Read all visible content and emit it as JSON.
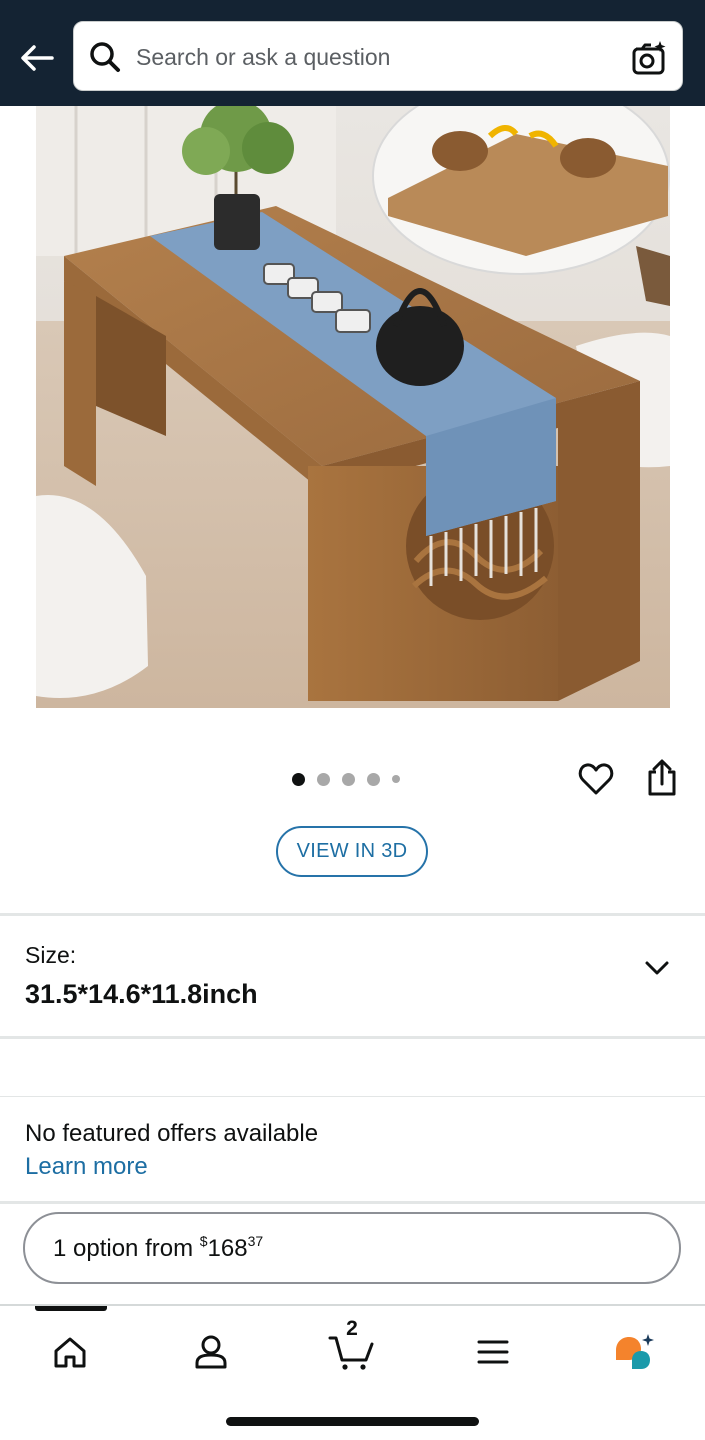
{
  "header": {
    "search_placeholder": "Search or ask a question",
    "background_color": "#142333"
  },
  "gallery": {
    "image_description_icon": "product-photo",
    "image_count": 5,
    "active_index": 0
  },
  "actions": {
    "view_3d_label": "VIEW IN 3D"
  },
  "size": {
    "label": "Size:",
    "value": "31.5*14.6*11.8inch"
  },
  "offers": {
    "title": "No featured offers available",
    "link": "Learn more"
  },
  "option": {
    "prefix": "1 option from ",
    "currency": "$",
    "price_whole": "168",
    "price_fraction": "37"
  },
  "tabbar": {
    "items": [
      "home-icon",
      "account-icon",
      "cart-icon",
      "menu-icon",
      "rufus-icon"
    ],
    "cart_count": "2",
    "active_index": 0
  },
  "colors": {
    "link": "#1d6ea3",
    "accent_orange": "#f4832c",
    "accent_teal": "#1b9aaa"
  }
}
